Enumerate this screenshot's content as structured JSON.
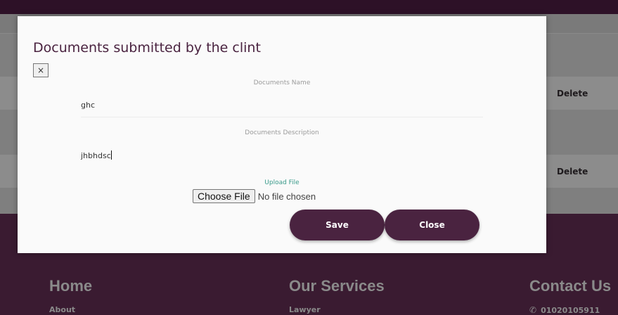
{
  "background": {
    "rows": [
      {
        "action_label": "Delete"
      },
      {
        "action_label": "Delete"
      }
    ],
    "footer": {
      "home": {
        "heading": "Home",
        "link": "About"
      },
      "services": {
        "heading": "Our Services",
        "link": "Lawyer"
      },
      "contact": {
        "heading": "Contact Us",
        "phone": "01020105911",
        "phone_icon": "phone-icon"
      }
    }
  },
  "modal": {
    "title": "Documents submitted by the clint",
    "close_symbol": "×",
    "fields": {
      "name": {
        "label": "Documents Name",
        "value": "ghc"
      },
      "description": {
        "label": "Documents Description",
        "value": "jhbhdsc"
      }
    },
    "upload": {
      "label": "Upload File",
      "button_label": "Choose File",
      "status": "No file chosen"
    },
    "buttons": {
      "save": "Save",
      "close": "Close"
    }
  },
  "colors": {
    "brand": "#4a2340",
    "upload_label": "#3a9a8a"
  }
}
